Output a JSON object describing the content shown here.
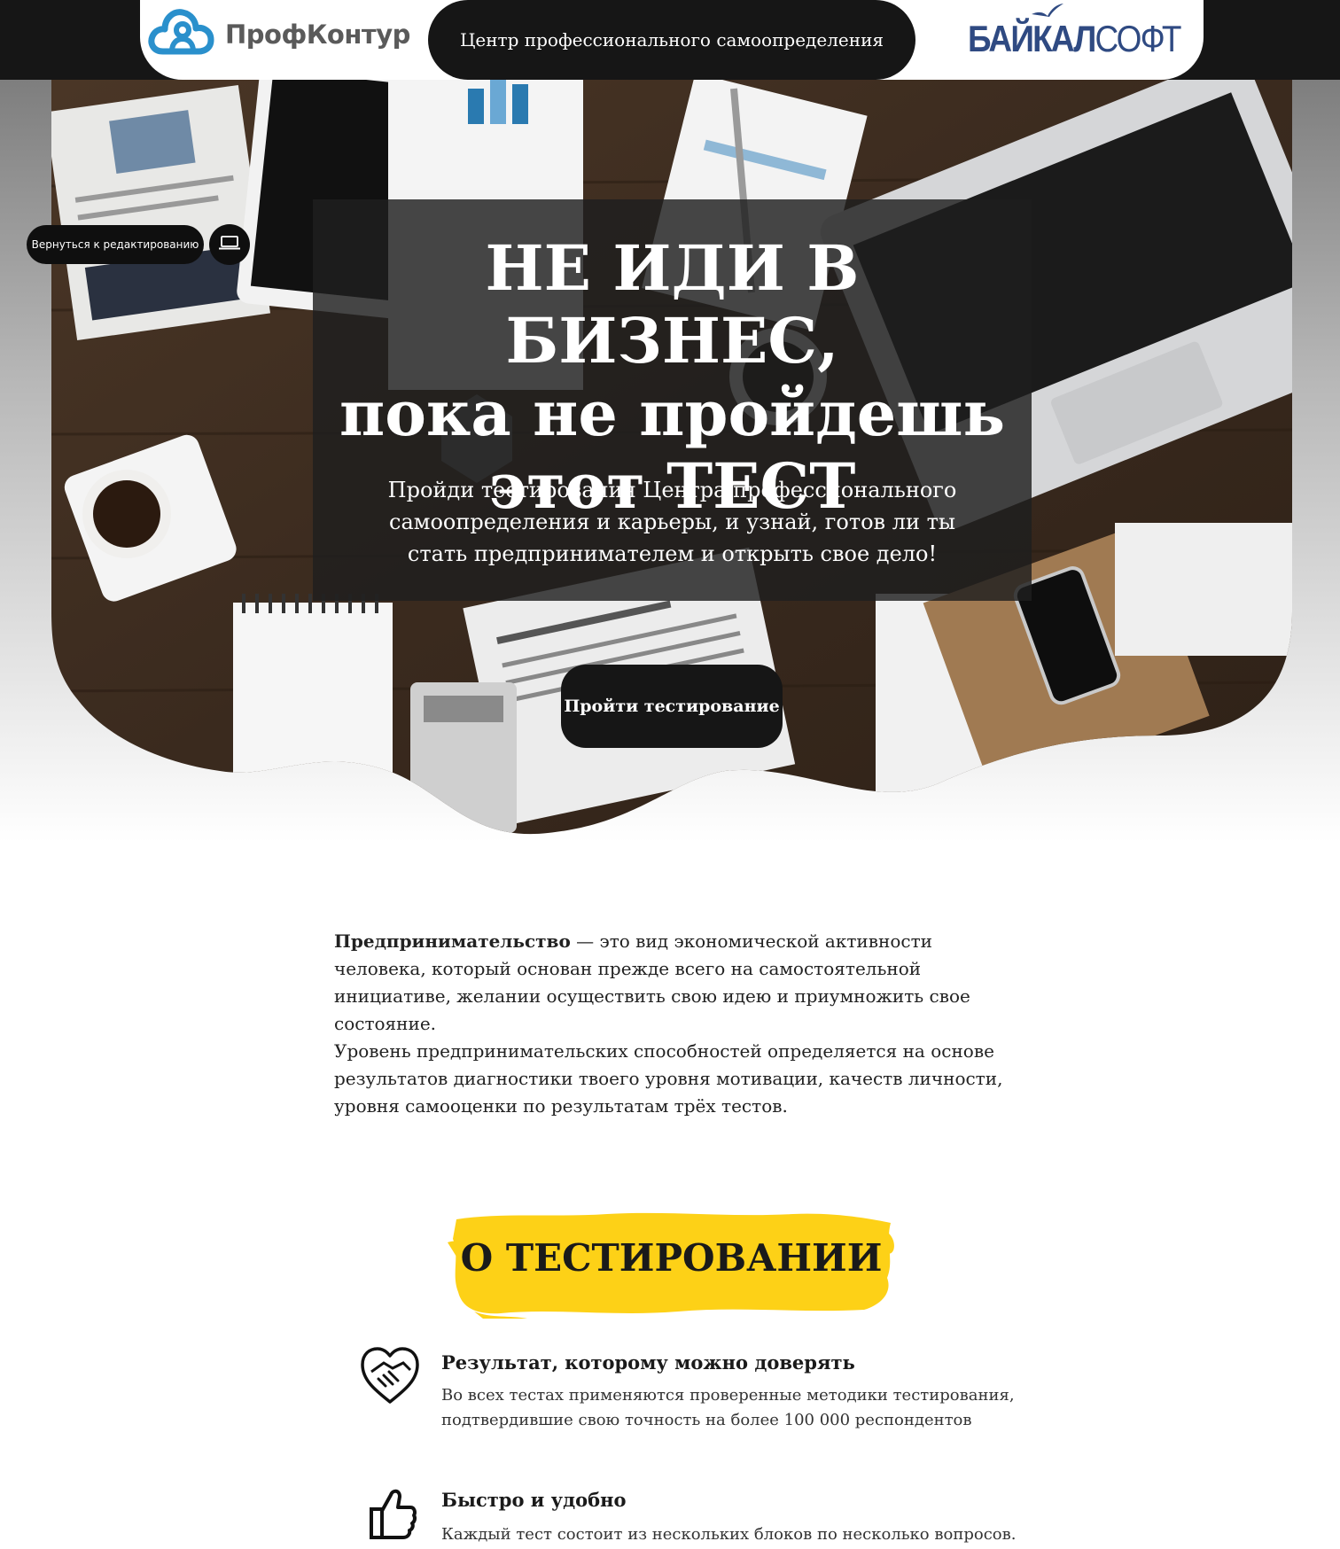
{
  "header": {
    "left_logo_name": "ПрофКонтур",
    "center_label": "Центр профессионального самоопределения",
    "right_logo_name_bold": "БАЙКАЛ",
    "right_logo_name_thin": "СОФТ"
  },
  "editor": {
    "back_label": "Вернуться к редактированию",
    "device_icon": "laptop-icon"
  },
  "hero": {
    "title_line1": "НЕ ИДИ В БИЗНЕС,",
    "title_line2": "пока не пройдешь",
    "title_line3": "этот ТЕСТ",
    "subtitle": "Пройди тестирования Центра профессионального самоопределения и карьеры, и узнай, готов ли ты стать предпринимателем и открыть свое дело!",
    "cta_label": "Пройти тестирование"
  },
  "intro": {
    "term": "Предпринимательство",
    "definition": " — это вид экономической активности человека, который основан прежде всего на самостоятельной инициативе, желании осуществить свою идею и приумножить свое состояние.",
    "paragraph2": "Уровень предпринимательских способностей определяется на основе результатов диагностики твоего уровня мотивации, качеств личности, уровня самооценки по результатам трёх тестов."
  },
  "about": {
    "heading": "О ТЕСТИРОВАНИИ",
    "features": [
      {
        "icon": "handshake-heart-icon",
        "title": "Результат, которому можно доверять",
        "text": "Во всех тестах применяются проверенные методики тестирования, подтвердившие свою точность на более 100 000 респондентов"
      },
      {
        "icon": "thumbs-up-icon",
        "title": "Быстро и удобно",
        "text": "Каждый тест состоит из нескольких блоков по несколько вопросов."
      }
    ]
  },
  "colors": {
    "dark": "#161616",
    "accent_yellow": "#fdd117",
    "logo_blue": "#2f4a82",
    "cloud_blue": "#2a90cc"
  }
}
